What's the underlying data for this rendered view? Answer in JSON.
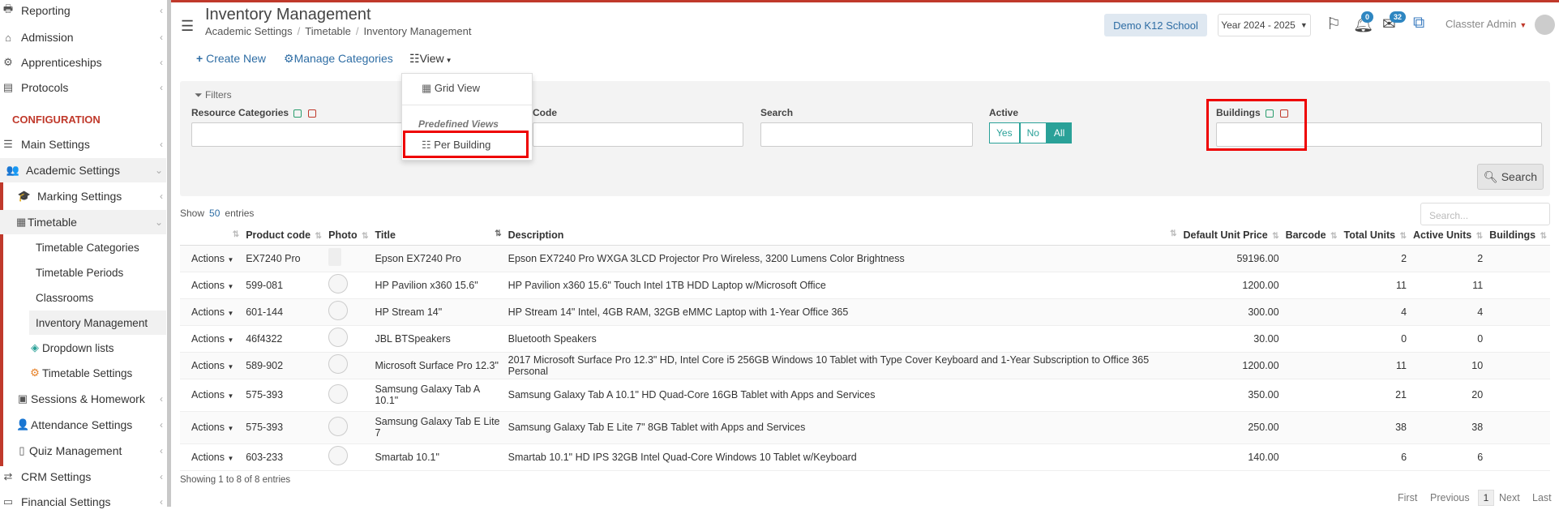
{
  "sidebar": {
    "items": [
      {
        "label": "Reporting",
        "icon": "printer-icon"
      },
      {
        "label": "Admission",
        "icon": "institution-icon"
      },
      {
        "label": "Apprenticeships",
        "icon": "gear-icon"
      },
      {
        "label": "Protocols",
        "icon": "file-cabinet-icon"
      }
    ],
    "section_title": "CONFIGURATION",
    "config_items": [
      {
        "label": "Main Settings",
        "icon": "sliders-icon"
      },
      {
        "label": "Academic Settings",
        "icon": "people-icon"
      },
      {
        "label": "Marking Settings",
        "icon": "graduation-cap-icon"
      },
      {
        "label": "Timetable",
        "icon": "calendar-icon"
      },
      {
        "label": "Timetable Categories"
      },
      {
        "label": "Timetable Periods"
      },
      {
        "label": "Classrooms"
      },
      {
        "label": "Inventory Management"
      },
      {
        "label": "Dropdown lists",
        "icon": "layers-icon"
      },
      {
        "label": "Timetable Settings",
        "icon": "cog-icon"
      },
      {
        "label": "Sessions & Homework",
        "icon": "chalkboard-icon"
      },
      {
        "label": "Attendance Settings",
        "icon": "user-check-icon"
      },
      {
        "label": "Quiz Management",
        "icon": "book-icon"
      },
      {
        "label": "CRM Settings",
        "icon": "random-icon"
      },
      {
        "label": "Financial Settings",
        "icon": "money-icon"
      }
    ]
  },
  "header": {
    "title": "Inventory Management",
    "breadcrumb": [
      "Academic Settings",
      "Timetable",
      "Inventory Management"
    ],
    "school": "Demo K12 School",
    "year": "Year 2024 - 2025",
    "notifications_count": "0",
    "messages_count": "32",
    "user": "Classter Admin"
  },
  "toolbar": {
    "create_new": "Create New",
    "manage_categories": "Manage Categories",
    "view": "View"
  },
  "view_menu": {
    "grid_view": "Grid View",
    "predefined_heading": "Predefined Views",
    "per_building": "Per Building"
  },
  "filters": {
    "title": "Filters",
    "resource_categories": "Resource Categories",
    "code": "Code",
    "search": "Search",
    "active": "Active",
    "active_options": [
      "Yes",
      "No",
      "All"
    ],
    "buildings": "Buildings",
    "search_button": "Search"
  },
  "table": {
    "show_prefix": "Show",
    "show_count": "50",
    "show_suffix": "entries",
    "search_placeholder": "Search...",
    "columns": [
      "Product code",
      "Photo",
      "Title",
      "Description",
      "Default Unit Price",
      "Barcode",
      "Total Units",
      "Active Units",
      "Buildings"
    ],
    "actions_label": "Actions",
    "rows": [
      {
        "code": "EX7240 Pro",
        "title": "Epson EX7240 Pro",
        "description": "Epson EX7240 Pro WXGA 3LCD Projector Pro Wireless, 3200 Lumens Color Brightness",
        "price": "59196.00",
        "total": "2",
        "active": "2"
      },
      {
        "code": "599-081",
        "title": "HP Pavilion x360 15.6\"",
        "description": "HP Pavilion x360 15.6\" Touch Intel 1TB HDD Laptop w/Microsoft Office",
        "price": "1200.00",
        "total": "11",
        "active": "11"
      },
      {
        "code": "601-144",
        "title": "HP Stream 14\"",
        "description": "HP Stream 14\" Intel, 4GB RAM, 32GB eMMC Laptop with 1-Year Office 365",
        "price": "300.00",
        "total": "4",
        "active": "4"
      },
      {
        "code": "46f4322",
        "title": "JBL BTSpeakers",
        "description": "Bluetooth Speakers",
        "price": "30.00",
        "total": "0",
        "active": "0"
      },
      {
        "code": "589-902",
        "title": "Microsoft Surface Pro 12.3\"",
        "description": "2017 Microsoft Surface Pro 12.3\" HD, Intel Core i5 256GB Windows 10 Tablet with Type Cover Keyboard and 1-Year Subscription to Office 365 Personal",
        "price": "1200.00",
        "total": "11",
        "active": "10"
      },
      {
        "code": "575-393",
        "title": "Samsung Galaxy Tab A 10.1\"",
        "description": "Samsung Galaxy Tab A 10.1\" HD Quad-Core 16GB Tablet with Apps and Services",
        "price": "350.00",
        "total": "21",
        "active": "20"
      },
      {
        "code": "575-393",
        "title": "Samsung Galaxy Tab E Lite 7",
        "description": "Samsung Galaxy Tab E Lite 7\" 8GB Tablet with Apps and Services",
        "price": "250.00",
        "total": "38",
        "active": "38"
      },
      {
        "code": "603-233",
        "title": "Smartab 10.1\"",
        "description": "Smartab 10.1\" HD IPS 32GB Intel Quad-Core Windows 10 Tablet w/Keyboard",
        "price": "140.00",
        "total": "6",
        "active": "6"
      }
    ],
    "footer": "Showing 1 to 8 of 8 entries",
    "pager": {
      "first": "First",
      "previous": "Previous",
      "current": "1",
      "next": "Next",
      "last": "Last"
    }
  }
}
